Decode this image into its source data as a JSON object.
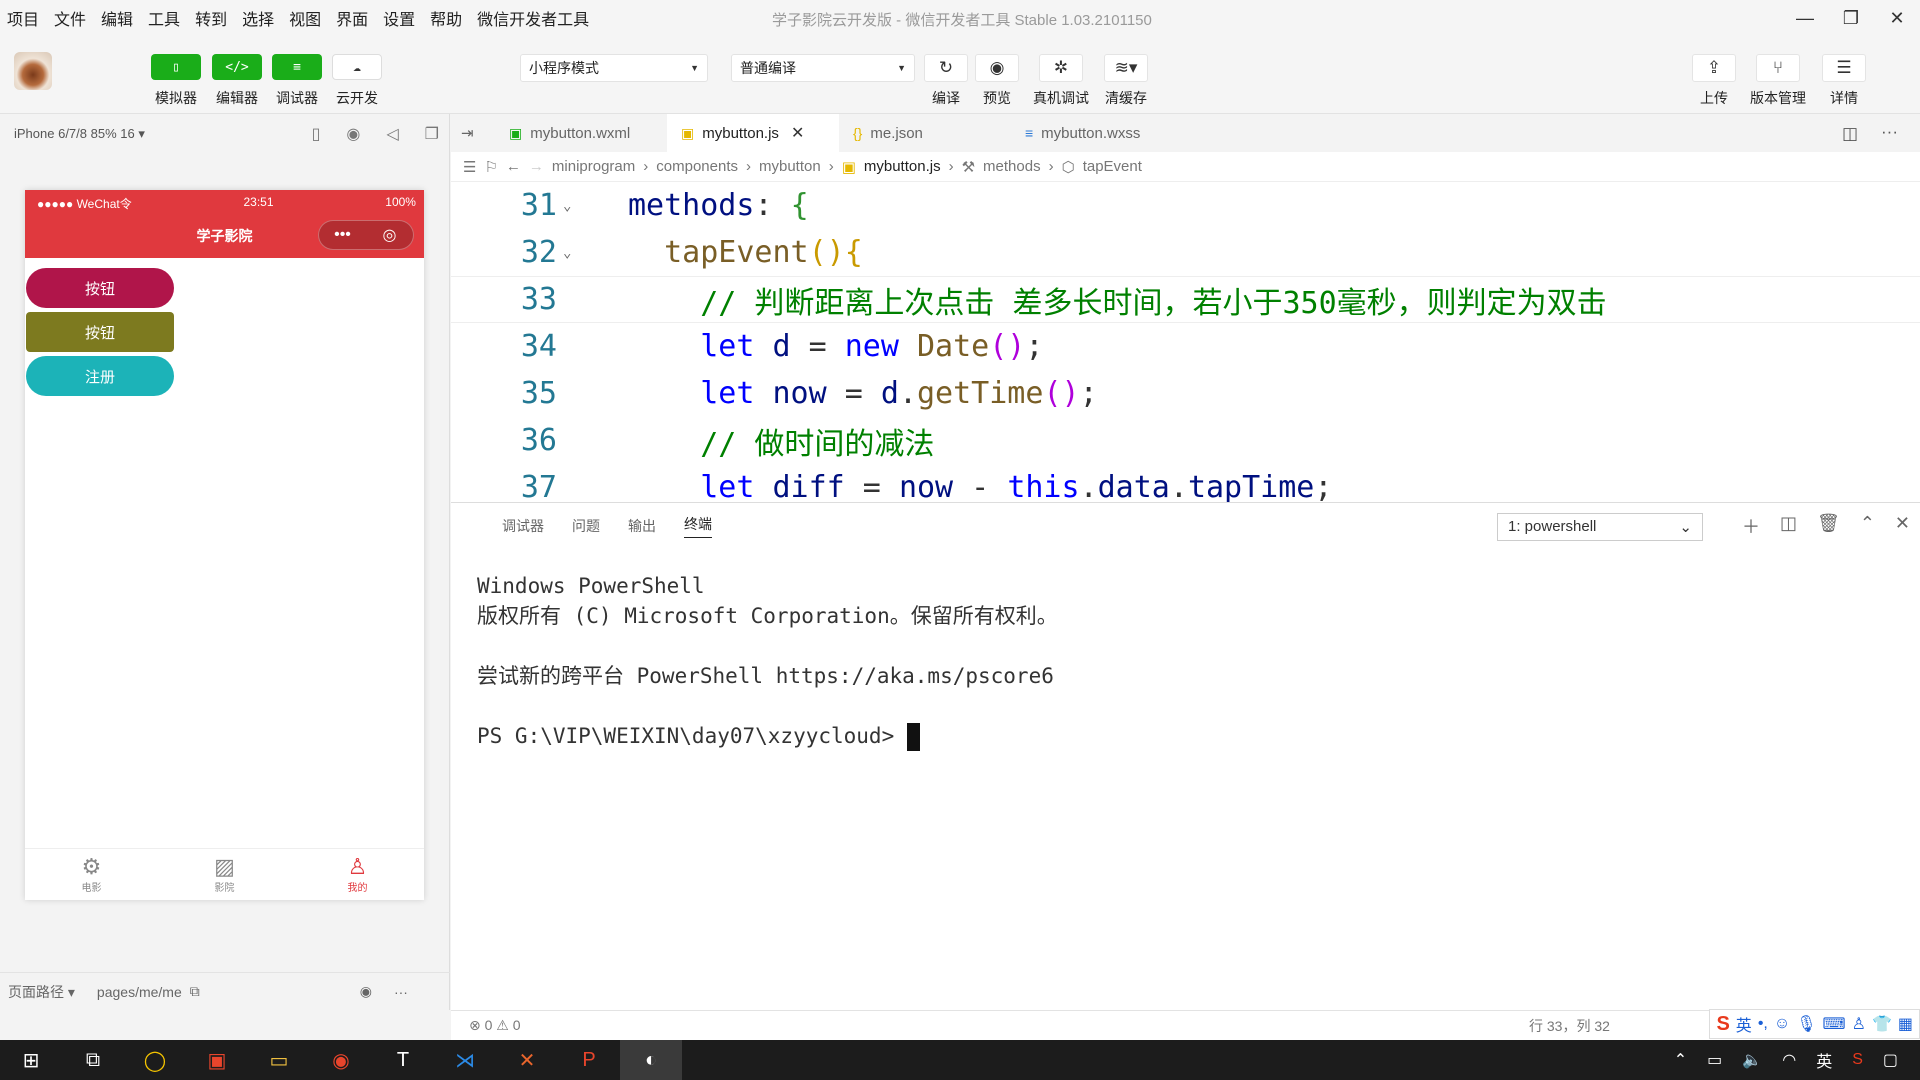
{
  "menubar": {
    "items": [
      "项目",
      "文件",
      "编辑",
      "工具",
      "转到",
      "选择",
      "视图",
      "界面",
      "设置",
      "帮助",
      "微信开发者工具"
    ],
    "window_title": "学子影院云开发版 - 微信开发者工具 Stable 1.03.2101150"
  },
  "toolbar": {
    "simulator": "模拟器",
    "editor": "编辑器",
    "debugger": "调试器",
    "cloud": "云开发",
    "mode_select": "小程序模式",
    "compile_select": "普通编译",
    "compile": "编译",
    "preview": "预览",
    "real_debug": "真机调试",
    "clear_cache": "清缓存",
    "upload": "上传",
    "version": "版本管理",
    "details": "详情"
  },
  "simulator": {
    "device": "iPhone 6/7/8 85% 16 ▾",
    "status_left": "●●●●● WeChat令",
    "status_time": "23:51",
    "status_right": "100%",
    "page_title": "学子影院",
    "buttons": [
      {
        "label": "按钮",
        "color": "#b0154a"
      },
      {
        "label": "按钮",
        "color": "#7d7a1f"
      },
      {
        "label": "注册",
        "color": "#1cb3b8"
      }
    ],
    "tabs": [
      {
        "label": "电影",
        "icon": "film-icon"
      },
      {
        "label": "影院",
        "icon": "cinema-icon"
      },
      {
        "label": "我的",
        "icon": "user-icon"
      }
    ],
    "footer_path_label": "页面路径 ▾",
    "footer_path": "pages/me/me"
  },
  "editor": {
    "tabs": [
      "mybutton.wxml",
      "mybutton.js",
      "me.json",
      "mybutton.wxss"
    ],
    "active_tab": "mybutton.js",
    "breadcrumb": [
      "miniprogram",
      "components",
      "mybutton",
      "mybutton.js",
      "methods",
      "tapEvent"
    ],
    "lines": [
      {
        "n": "31",
        "text": "methods: {"
      },
      {
        "n": "32",
        "text": "  tapEvent(){"
      },
      {
        "n": "33",
        "text": "    // 判断距离上次点击 差多长时间，若小于350毫秒，则判定为双击"
      },
      {
        "n": "34",
        "text": "    let d = new Date();"
      },
      {
        "n": "35",
        "text": "    let now = d.getTime();"
      },
      {
        "n": "36",
        "text": "    // 做时间的减法"
      },
      {
        "n": "37",
        "text": "    let diff = now - this.data.tapTime;"
      }
    ]
  },
  "panel": {
    "tabs": [
      "调试器",
      "问题",
      "输出",
      "终端"
    ],
    "active_tab": "终端",
    "terminal_select": "1: powershell",
    "terminal_lines": [
      "Windows PowerShell",
      "版权所有 (C) Microsoft Corporation。保留所有权利。",
      "",
      "尝试新的跨平台 PowerShell https://aka.ms/pscore6",
      ""
    ],
    "prompt": "PS G:\\VIP\\WEIXIN\\day07\\xzyycloud> "
  },
  "statusbar": {
    "problems": "⊗ 0 ⚠ 0",
    "position": "行 33，列 32",
    "ime": "英"
  }
}
